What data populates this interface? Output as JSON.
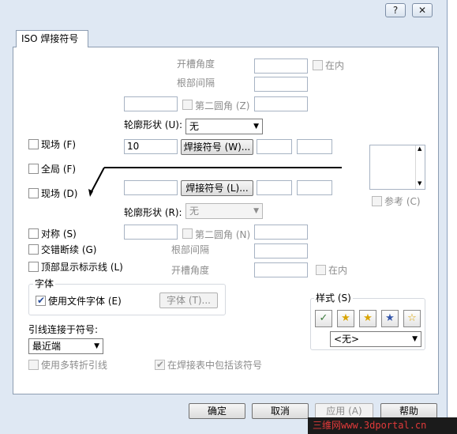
{
  "title_bar": {
    "help": "?",
    "close": "✕"
  },
  "tab": {
    "label": "ISO 焊接符号"
  },
  "top": {
    "groove_angle_label": "开槽角度",
    "groove_angle_value": "",
    "inside_label": "在内",
    "root_gap_label": "根部间隔",
    "root_gap_value": "",
    "left_field_value": "",
    "second_fillet_label": "第二圆角 (Z)",
    "second_fillet_value": "",
    "contour_label": "轮廓形状 (U):",
    "contour_value": "无",
    "field_site_label": "现场 (F)",
    "size_value": "10",
    "weld_symbol_button": "焊接符号 (W)...",
    "upper_field_a": "",
    "upper_field_b": ""
  },
  "middle": {
    "all_around_label": "全局 (F)",
    "field_site2_label": "现场 (D)",
    "lower_size_value": "",
    "weld_symbol_lower_button": "焊接符号 (L)...",
    "lower_field_a": "",
    "lower_field_b": "",
    "contour2_label": "轮廓形状 (R):",
    "contour2_value": "无",
    "reference_label": "参考 (C)"
  },
  "bottom": {
    "symmetric_label": "对称 (S)",
    "symmetric_field": "",
    "second_fillet2_label": "第二圆角 (N)",
    "second_fillet2_value": "",
    "staggered_label": "交错断续 (G)",
    "root_gap2_label": "根部间隔",
    "root_gap2_value": "",
    "show_id_line_label": "顶部显示标示线 (L)",
    "groove_angle2_label": "开槽角度",
    "groove_angle2_value": "",
    "inside2_label": "在内"
  },
  "font_group": {
    "title": "字体",
    "use_doc_font_label": "使用文件字体 (E)",
    "use_doc_font_checked": true,
    "font_button": "字体 (T)..."
  },
  "leader": {
    "label": "引线连接于符号:",
    "value": "最近端",
    "multi_jog_label": "使用多转折引线",
    "include_in_table_label": "在焊接表中包括该符号",
    "include_in_table_checked": true
  },
  "style": {
    "title": "样式 (S)",
    "value": "<无>",
    "buttons": [
      "update-style-icon",
      "add-style-icon",
      "delete-style-icon",
      "save-style-icon",
      "load-style-icon"
    ]
  },
  "footer": {
    "ok": "确定",
    "cancel": "取消",
    "apply": "应用 (A)",
    "help": "帮助"
  },
  "watermark": "三维网www.3dportal.cn"
}
